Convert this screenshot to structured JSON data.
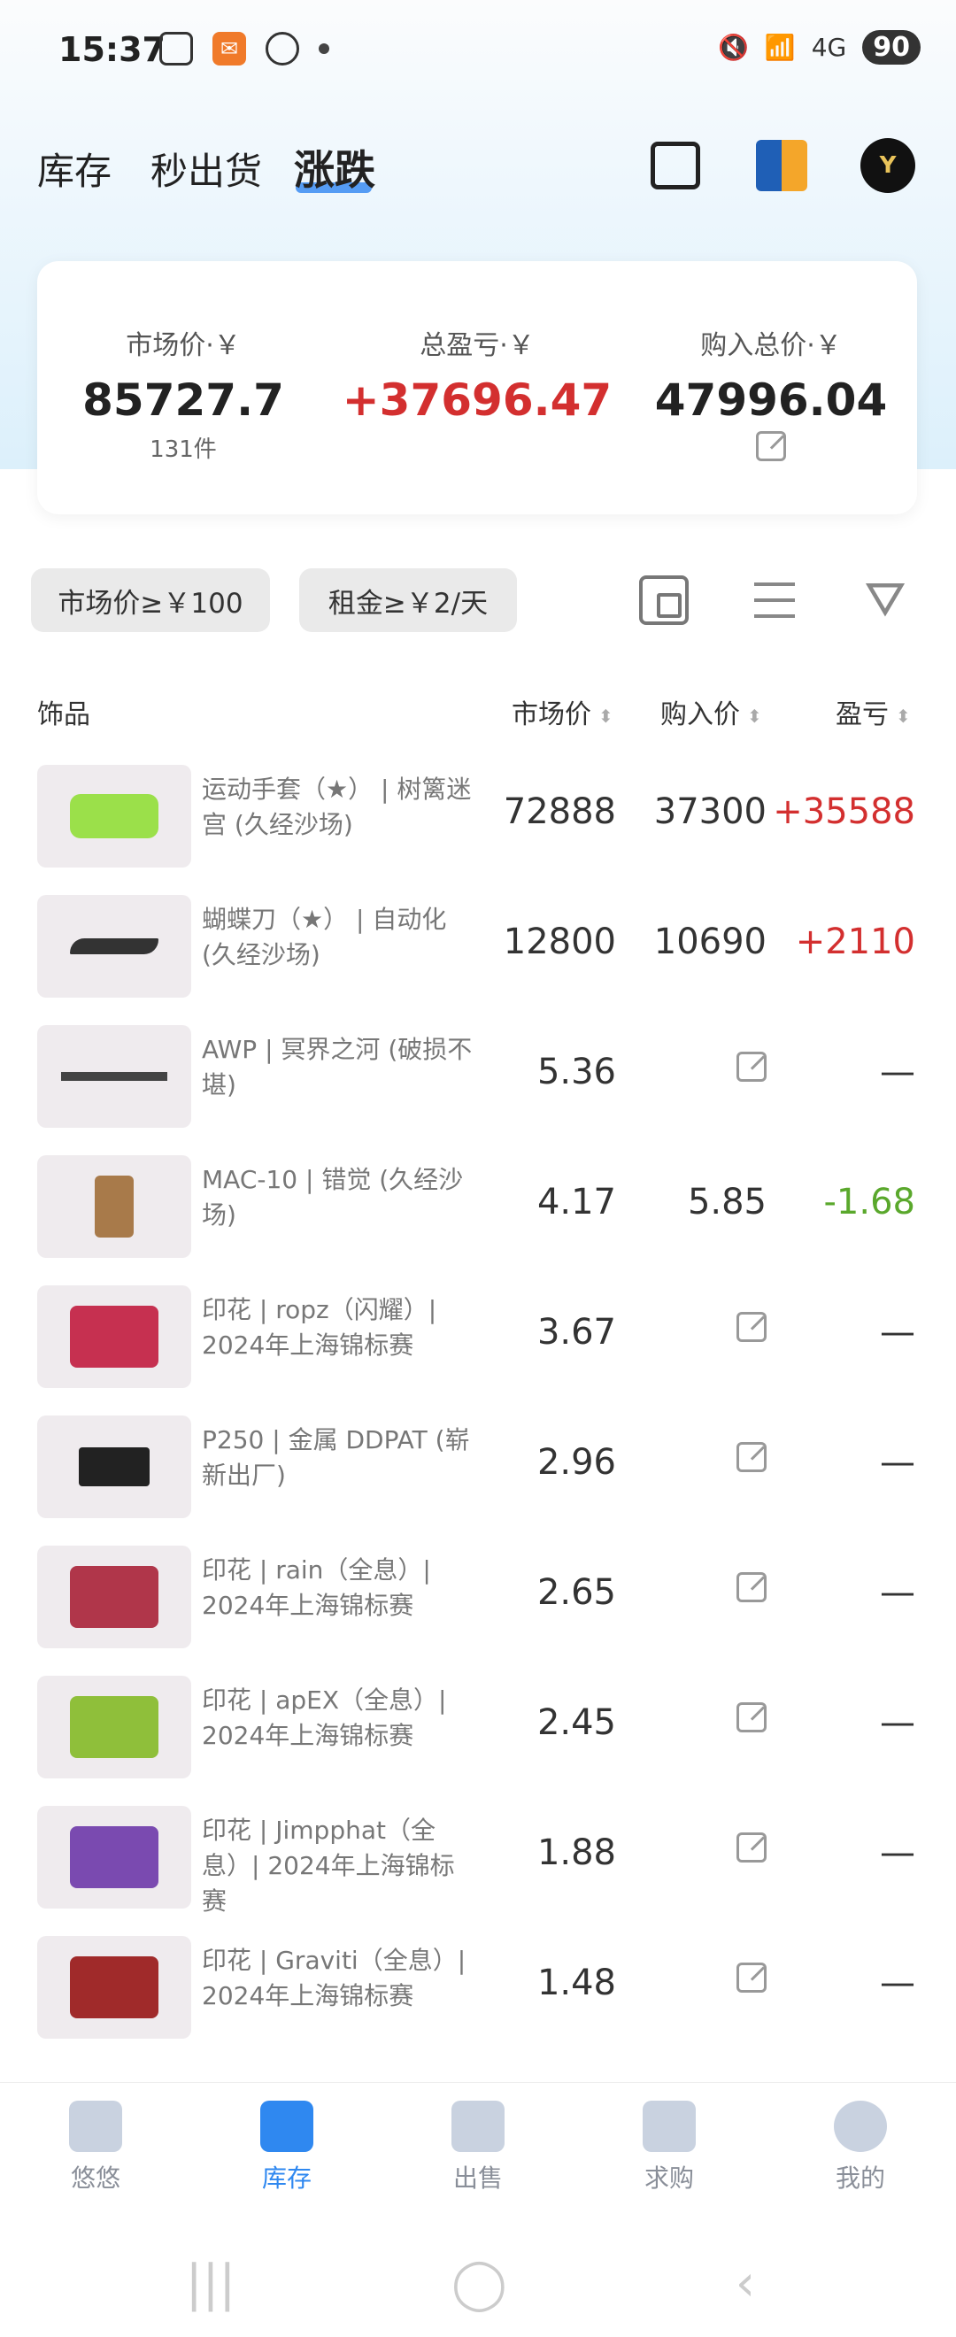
{
  "status_bar": {
    "time": "15:37",
    "battery": "90",
    "network": "4G"
  },
  "header": {
    "tabs": [
      {
        "label": "库存",
        "active": false
      },
      {
        "label": "秒出货",
        "active": false
      },
      {
        "label": "涨跌",
        "active": true
      }
    ],
    "accent_color": "#3a8cf2"
  },
  "summary": {
    "market_label": "市场价·￥",
    "market_value": "85727.7",
    "market_count": "131件",
    "pl_label": "总盈亏·￥",
    "pl_value": "+37696.47",
    "buy_label": "购入总价·￥",
    "buy_value": "47996.04"
  },
  "filters": {
    "chip_market": "市场价≥￥100",
    "chip_rent": "租金≥￥2/天"
  },
  "columns": {
    "item": "饰品",
    "market": "市场价",
    "buy": "购入价",
    "pl": "盈亏"
  },
  "rows": [
    {
      "name": "运动手套（★） | 树篱迷宫 (久经沙场)",
      "market": "72888",
      "buy": "37300",
      "pl": "+35588",
      "pl_type": "pos",
      "thumb_color": "#9be04a"
    },
    {
      "name": "蝴蝶刀（★） | 自动化 (久经沙场)",
      "market": "12800",
      "buy": "10690",
      "pl": "+2110",
      "pl_type": "pos",
      "thumb_color": "#333333"
    },
    {
      "name": "AWP | 冥界之河 (破损不堪)",
      "market": "5.36",
      "buy": "",
      "pl": "—",
      "pl_type": "none",
      "thumb_color": "#444444"
    },
    {
      "name": "MAC-10 | 错觉 (久经沙场)",
      "market": "4.17",
      "buy": "5.85",
      "pl": "-1.68",
      "pl_type": "neg",
      "thumb_color": "#a87a4a"
    },
    {
      "name": "印花 | ropz（闪耀）| 2024年上海锦标赛",
      "market": "3.67",
      "buy": "",
      "pl": "—",
      "pl_type": "none",
      "thumb_color": "#c63050"
    },
    {
      "name": "P250 | 金属 DDPAT (崭新出厂)",
      "market": "2.96",
      "buy": "",
      "pl": "—",
      "pl_type": "none",
      "thumb_color": "#222222"
    },
    {
      "name": "印花 | rain（全息）| 2024年上海锦标赛",
      "market": "2.65",
      "buy": "",
      "pl": "—",
      "pl_type": "none",
      "thumb_color": "#b0364a"
    },
    {
      "name": "印花 | apEX（全息）| 2024年上海锦标赛",
      "market": "2.45",
      "buy": "",
      "pl": "—",
      "pl_type": "none",
      "thumb_color": "#8fbf3a"
    },
    {
      "name": "印花 | Jimpphat（全息）| 2024年上海锦标赛",
      "market": "1.88",
      "buy": "",
      "pl": "—",
      "pl_type": "none",
      "thumb_color": "#7a4ab0"
    },
    {
      "name": "印花 | Graviti（全息）| 2024年上海锦标赛",
      "market": "1.48",
      "buy": "",
      "pl": "—",
      "pl_type": "none",
      "thumb_color": "#a02a2a"
    }
  ],
  "bottom_nav": [
    {
      "label": "悠悠",
      "icon": "shop-icon",
      "active": false
    },
    {
      "label": "库存",
      "icon": "inventory-icon",
      "active": true
    },
    {
      "label": "出售",
      "icon": "sell-icon",
      "active": false
    },
    {
      "label": "求购",
      "icon": "wanted-icon",
      "active": false
    },
    {
      "label": "我的",
      "icon": "profile-icon",
      "active": false
    }
  ]
}
